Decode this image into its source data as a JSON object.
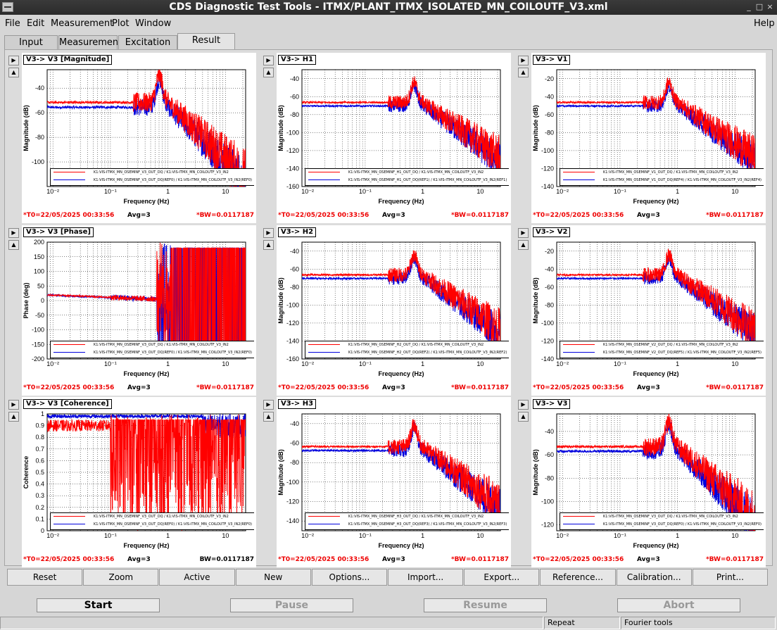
{
  "window": {
    "title": "CDS Diagnostic Test Tools - ITMX/PLANT_ITMX_ISOLATED_MN_COILOUTF_V3.xml",
    "buttons": [
      "_",
      "□",
      "×"
    ]
  },
  "menu": {
    "items": [
      "File",
      "Edit",
      "Measurement",
      "Plot",
      "Window"
    ],
    "help": "Help"
  },
  "tabs": [
    {
      "label": "Input"
    },
    {
      "label": "Measurement"
    },
    {
      "label": "Excitation"
    },
    {
      "label": "Result"
    }
  ],
  "colors": {
    "red": "#ff0000",
    "blue": "#0000dd"
  },
  "footer": {
    "t0": "*T0=22/05/2025 00:33:56",
    "avg": "Avg=3",
    "bw_red": "*BW=0.0117187",
    "bw_plain": "BW=0.0117187"
  },
  "xaxis": {
    "label": "Frequency (Hz)",
    "ticks": [
      "10⁻²",
      "10⁻¹",
      "1",
      "10"
    ]
  },
  "panels": [
    {
      "title": "V3-> V3 [Magnitude]",
      "ylabel": "Magnitude (dB)",
      "yticks": [
        "-40",
        "-60",
        "-80",
        "-100"
      ],
      "ylim": [
        -120,
        -25
      ],
      "type": "mag",
      "legend": [
        "K1:VIS-ITMX_MN_OSEMINF_V3_OUT_DQ / K1:VIS-ITMX_MN_COILOUTF_V3_IN2",
        "K1:VIS-ITMX_MN_OSEMINF_V3_OUT_DQ(REF0) / K1:VIS-ITMX_MN_COILOUTF_V3_IN2(REF0)"
      ]
    },
    {
      "title": "V3-> H1",
      "ylabel": "Magnitude (dB)",
      "yticks": [
        "-40",
        "-60",
        "-80",
        "-100",
        "-120",
        "-140",
        "-160"
      ],
      "ylim": [
        -160,
        -30
      ],
      "type": "mag",
      "legend": [
        "K1:VIS-ITMX_MN_OSEMINF_H1_OUT_DQ / K1:VIS-ITMX_MN_COILOUTF_V3_IN2",
        "K1:VIS-ITMX_MN_OSEMINF_H1_OUT_DQ(REF1) / K1:VIS-ITMX_MN_COILOUTF_V3_IN2(REF1)"
      ]
    },
    {
      "title": "V3-> V1",
      "ylabel": "Magnitude (dB)",
      "yticks": [
        "-20",
        "-40",
        "-60",
        "-80",
        "-100",
        "-120",
        "-140"
      ],
      "ylim": [
        -140,
        -10
      ],
      "type": "mag",
      "legend": [
        "K1:VIS-ITMX_MN_OSEMINF_V1_OUT_DQ / K1:VIS-ITMX_MN_COILOUTF_V3_IN2",
        "K1:VIS-ITMX_MN_OSEMINF_V1_OUT_DQ(REF4) / K1:VIS-ITMX_MN_COILOUTF_V3_IN2(REF4)"
      ]
    },
    {
      "title": "V3-> V3 [Phase]",
      "ylabel": "Phase (deg)",
      "yticks": [
        "200",
        "150",
        "100",
        "50",
        "0",
        "-50",
        "-100",
        "-150",
        "-200"
      ],
      "ylim": [
        -200,
        200
      ],
      "type": "phase",
      "legend": [
        "K1:VIS-ITMX_MN_OSEMINF_V3_OUT_DQ / K1:VIS-ITMX_MN_COILOUTF_V3_IN2",
        "K1:VIS-ITMX_MN_OSEMINF_V3_OUT_DQ(REF0) / K1:VIS-ITMX_MN_COILOUTF_V3_IN2(REF0)"
      ]
    },
    {
      "title": "V3-> H2",
      "ylabel": "Magnitude (dB)",
      "yticks": [
        "-40",
        "-60",
        "-80",
        "-100",
        "-120",
        "-140",
        "-160"
      ],
      "ylim": [
        -160,
        -30
      ],
      "type": "mag",
      "legend": [
        "K1:VIS-ITMX_MN_OSEMINF_H2_OUT_DQ / K1:VIS-ITMX_MN_COILOUTF_V3_IN2",
        "K1:VIS-ITMX_MN_OSEMINF_H2_OUT_DQ(REF2) / K1:VIS-ITMX_MN_COILOUTF_V3_IN2(REF2)"
      ]
    },
    {
      "title": "V3-> V2",
      "ylabel": "Magnitude (dB)",
      "yticks": [
        "-20",
        "-40",
        "-60",
        "-80",
        "-100",
        "-120",
        "-140"
      ],
      "ylim": [
        -140,
        -10
      ],
      "type": "mag",
      "legend": [
        "K1:VIS-ITMX_MN_OSEMINF_V2_OUT_DQ / K1:VIS-ITMX_MN_COILOUTF_V3_IN2",
        "K1:VIS-ITMX_MN_OSEMINF_V2_OUT_DQ(REF5) / K1:VIS-ITMX_MN_COILOUTF_V3_IN2(REF5)"
      ]
    },
    {
      "title": "V3-> V3 [Coherence]",
      "ylabel": "Coherence",
      "yticks": [
        "1",
        "0.9",
        "0.8",
        "0.7",
        "0.6",
        "0.5",
        "0.4",
        "0.3",
        "0.2",
        "0.1",
        "0"
      ],
      "ylim": [
        0,
        1
      ],
      "type": "coh",
      "legend": [
        "K1:VIS-ITMX_MN_OSEMINF_V3_OUT_DQ / K1:VIS-ITMX_MN_COILOUTF_V3_IN2",
        "K1:VIS-ITMX_MN_OSEMINF_V3_OUT_DQ(REF0) / K1:VIS-ITMX_MN_COILOUTF_V3_IN2(REF0)"
      ]
    },
    {
      "title": "V3-> H3",
      "ylabel": "Magnitude (dB)",
      "yticks": [
        "-40",
        "-60",
        "-80",
        "-100",
        "-120",
        "-140"
      ],
      "ylim": [
        -150,
        -30
      ],
      "type": "mag",
      "legend": [
        "K1:VIS-ITMX_MN_OSEMINF_H3_OUT_DQ / K1:VIS-ITMX_MN_COILOUTF_V3_IN2",
        "K1:VIS-ITMX_MN_OSEMINF_H3_OUT_DQ(REF3) / K1:VIS-ITMX_MN_COILOUTF_V3_IN2(REF3)"
      ]
    },
    {
      "title": "V3-> V3",
      "ylabel": "Magnitude (dB)",
      "yticks": [
        "-40",
        "-60",
        "-80",
        "-100",
        "-120"
      ],
      "ylim": [
        -125,
        -25
      ],
      "type": "mag",
      "legend": [
        "K1:VIS-ITMX_MN_OSEMINF_V3_OUT_DQ / K1:VIS-ITMX_MN_COILOUTF_V3_IN2",
        "K1:VIS-ITMX_MN_OSEMINF_V3_OUT_DQ(REF0) / K1:VIS-ITMX_MN_COILOUTF_V3_IN2(REF0)"
      ]
    }
  ],
  "toolbar": [
    "Reset",
    "Zoom",
    "Active",
    "New",
    "Options...",
    "Import...",
    "Export...",
    "Reference...",
    "Calibration...",
    "Print..."
  ],
  "controls": [
    {
      "label": "Start",
      "enabled": true
    },
    {
      "label": "Pause",
      "enabled": false
    },
    {
      "label": "Resume",
      "enabled": false
    },
    {
      "label": "Abort",
      "enabled": false
    }
  ],
  "status": {
    "repeat": "Repeat",
    "fourier": "Fourier tools"
  }
}
